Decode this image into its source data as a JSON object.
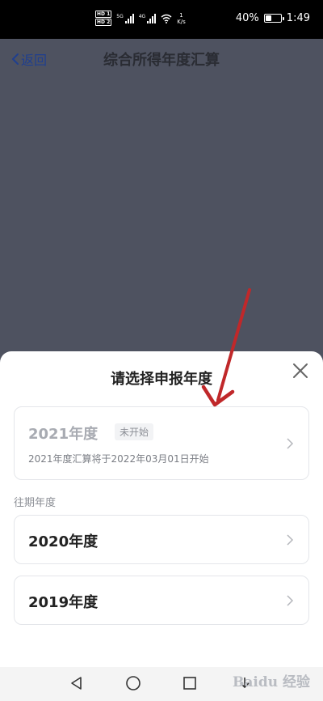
{
  "status_bar": {
    "hd1": "HD 1",
    "hd2": "HD 2",
    "net1": "5G",
    "net2": "4G",
    "speed_value": "1",
    "speed_unit": "K/s",
    "battery": "40%",
    "battery_level": 0.4,
    "time": "1:49"
  },
  "nav": {
    "back_label": "返回",
    "title": "综合所得年度汇算"
  },
  "sheet": {
    "title": "请选择申报年度",
    "current": {
      "year": "2021年度",
      "tag": "未开始",
      "desc": "2021年度汇算将于2022年03月01日开始"
    },
    "past_label": "往期年度",
    "past_years": [
      {
        "year": "2020年度"
      },
      {
        "year": "2019年度"
      }
    ]
  },
  "watermark": "Baidu 经验",
  "colors": {
    "annotation_arrow": "#c0282a",
    "back_link": "#1f3f8f",
    "overlay": "#4e5260"
  }
}
